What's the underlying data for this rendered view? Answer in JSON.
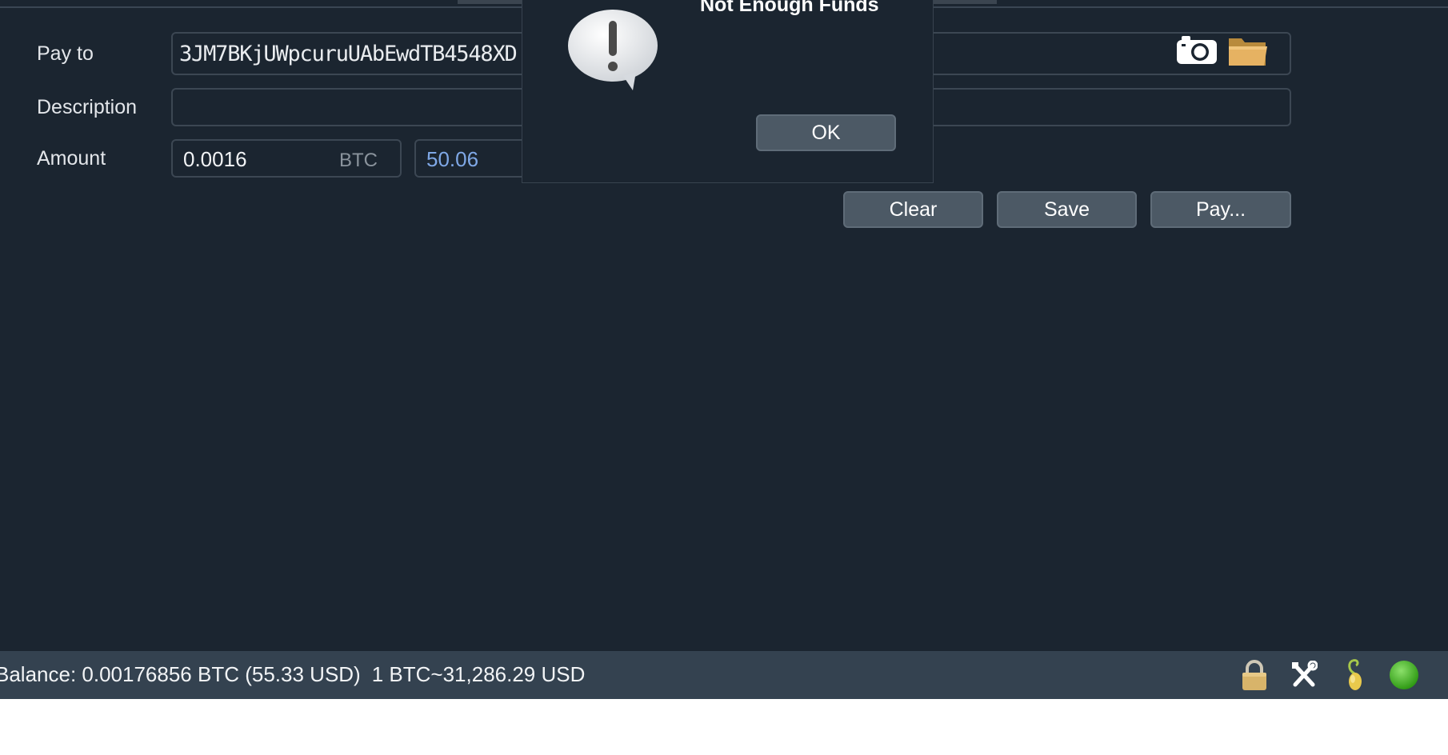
{
  "form": {
    "pay_to_label": "Pay to",
    "pay_to_value": "3JM7BKjUWpcuruUAbEwdTB4548XD",
    "description_label": "Description",
    "description_value": "",
    "amount_label": "Amount",
    "amount_value": "0.0016",
    "amount_unit": "BTC",
    "fiat_value": "50.06"
  },
  "buttons": {
    "clear": "Clear",
    "save": "Save",
    "pay": "Pay..."
  },
  "dialog": {
    "title": "Not Enough Funds",
    "ok": "OK"
  },
  "status": {
    "balance": "Balance: 0.00176856 BTC (55.33 USD)",
    "rate": "1 BTC~31,286.29 USD"
  },
  "icons": [
    "camera-icon",
    "folder-icon",
    "lock-icon",
    "tools-icon",
    "seed-icon",
    "network-status-icon",
    "warning-icon"
  ],
  "colors": {
    "background": "#1b2530",
    "status_bar": "#344250",
    "button": "#4c5965",
    "fiat_text": "#7fa8e6",
    "network_ok": "#3fb21d"
  }
}
